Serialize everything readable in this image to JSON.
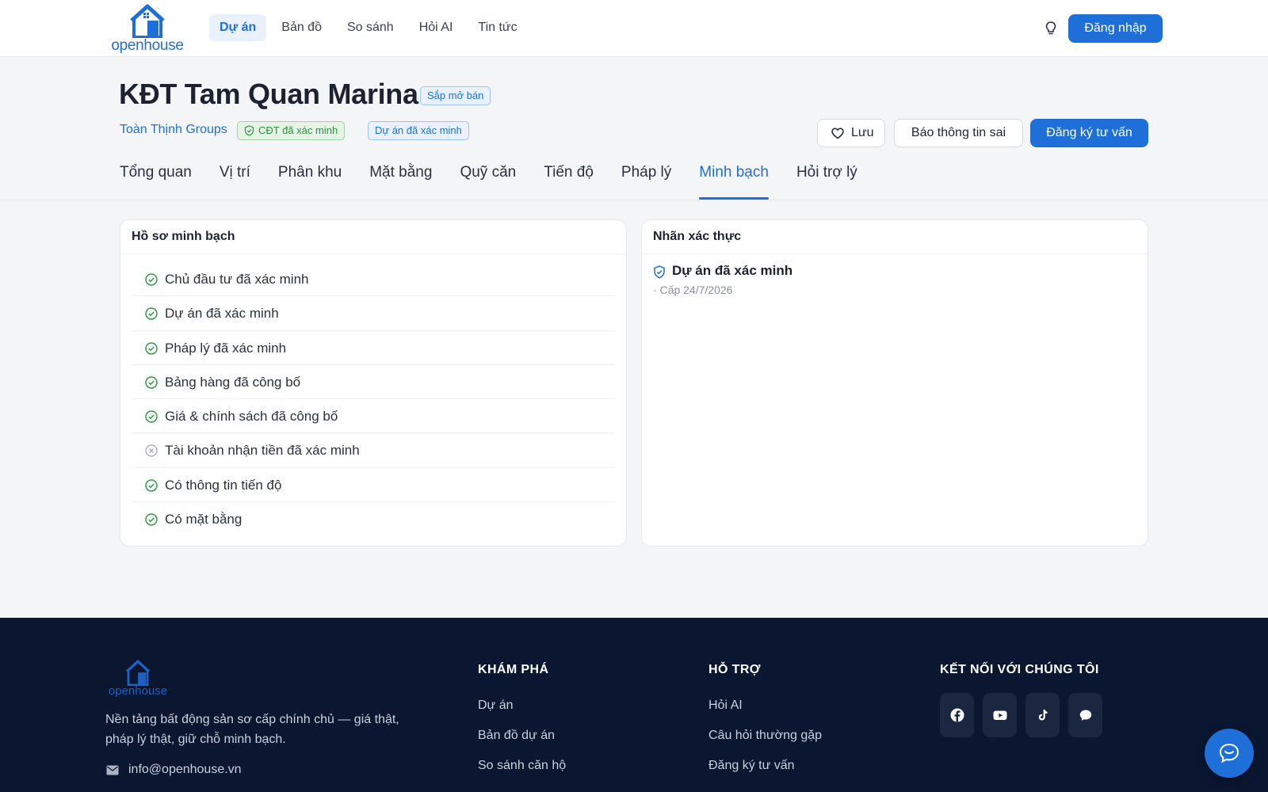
{
  "brand": {
    "name": "openhouse",
    "primary_color": "#1f6fd8"
  },
  "nav": {
    "items": [
      {
        "label": "Dự án",
        "active": true
      },
      {
        "label": "Bản đồ",
        "active": false
      },
      {
        "label": "So sánh",
        "active": false
      },
      {
        "label": "Hỏi AI",
        "active": false
      },
      {
        "label": "Tin tức",
        "active": false
      }
    ],
    "theme_icon": "lightbulb-icon",
    "login_label": "Đăng nhập"
  },
  "project": {
    "title": "KĐT Tam Quan Marina",
    "status_tag": "Sắp mở bán",
    "developer": "Toàn Thịnh Groups",
    "developer_badge": "CĐT đã xác minh",
    "project_badge": "Dự án đã xác minh",
    "actions": {
      "save": "Lưu",
      "report": "Báo thông tin sai",
      "consult": "Đăng ký tư vấn"
    },
    "tabs": [
      {
        "label": "Tổng quan",
        "active": false
      },
      {
        "label": "Vị trí",
        "active": false
      },
      {
        "label": "Phân khu",
        "active": false
      },
      {
        "label": "Mặt bằng",
        "active": false
      },
      {
        "label": "Quỹ căn",
        "active": false
      },
      {
        "label": "Tiến độ",
        "active": false
      },
      {
        "label": "Pháp lý",
        "active": false
      },
      {
        "label": "Minh bạch",
        "active": true
      },
      {
        "label": "Hỏi trợ lý",
        "active": false
      }
    ]
  },
  "transparency": {
    "title": "Hồ sơ minh bạch",
    "items": [
      {
        "label": "Chủ đầu tư đã xác minh",
        "status": "verified"
      },
      {
        "label": "Dự án đã xác minh",
        "status": "verified"
      },
      {
        "label": "Pháp lý đã xác minh",
        "status": "verified"
      },
      {
        "label": "Bảng hàng đã công bố",
        "status": "verified"
      },
      {
        "label": "Giá & chính sách đã công bố",
        "status": "verified"
      },
      {
        "label": "Tài khoản nhận tiền đã xác minh",
        "status": "unverified"
      },
      {
        "label": "Có thông tin tiến độ",
        "status": "verified"
      },
      {
        "label": "Có mặt bằng",
        "status": "verified"
      }
    ]
  },
  "labels": {
    "title": "Nhãn xác thực",
    "badge_name": "Dự án đã xác minh",
    "badge_date": "· Cấp 24/7/2026"
  },
  "footer": {
    "brand": "openhouse",
    "description": "Nền tảng bất động sản sơ cấp chính chủ — giá thật, pháp lý thật, giữ chỗ minh bạch.",
    "email": "info@openhouse.vn",
    "explore": {
      "title": "KHÁM PHÁ",
      "links": [
        "Dự án",
        "Bản đồ dự án",
        "So sánh căn hộ"
      ]
    },
    "support": {
      "title": "HỖ TRỢ",
      "links": [
        "Hỏi AI",
        "Câu hỏi thường gặp",
        "Đăng ký tư vấn"
      ]
    },
    "connect": {
      "title": "KẾT NỐI VỚI CHÚNG TÔI",
      "socials": [
        "facebook-icon",
        "youtube-icon",
        "tiktok-icon",
        "chat-bubble-icon"
      ]
    }
  },
  "colors": {
    "verified": "#2f9e44",
    "unverified": "#9aa0aa",
    "footer_bg": "#0b1631"
  }
}
